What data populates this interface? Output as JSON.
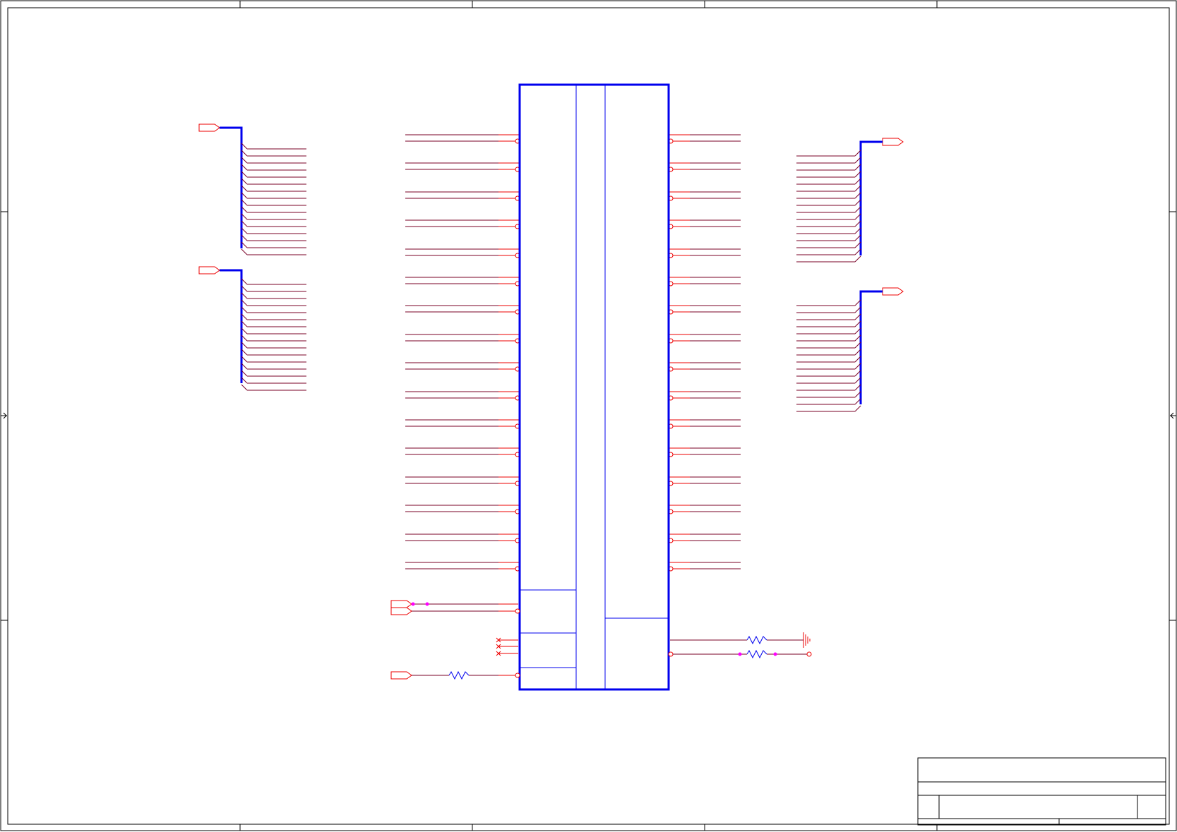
{
  "drawing": {
    "colors": {
      "frame": "#000000",
      "component_outline": "#0000ee",
      "bus": "#0000ee",
      "pin": "#ee0000",
      "net_wire": "#7a0026",
      "port": "#ee0000",
      "resistor": "#0000ee",
      "junction": "#ff00ff"
    },
    "left_buses": [
      {
        "name": "",
        "entries": 16
      },
      {
        "name": "",
        "entries": 16
      }
    ],
    "right_buses": [
      {
        "name": "",
        "entries": 16
      },
      {
        "name": "",
        "entries": 16
      }
    ],
    "ic": {
      "reference": "",
      "left_pin_pairs": 16,
      "right_pin_pairs": 16,
      "section_labels": []
    },
    "title_block": {
      "title": "",
      "size": "",
      "document_number": "",
      "revision": "",
      "date": "",
      "sheet": ""
    }
  }
}
